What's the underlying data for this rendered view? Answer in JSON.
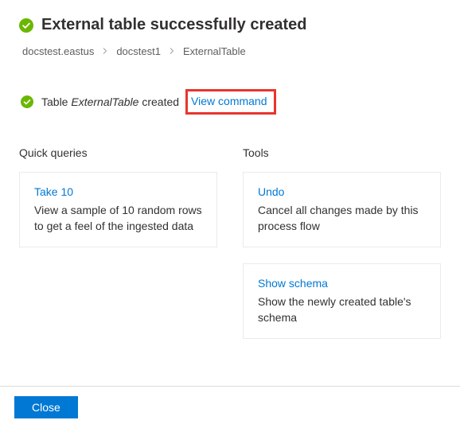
{
  "header": {
    "title": "External table successfully created"
  },
  "breadcrumb": {
    "items": [
      "docstest.eastus",
      "docstest1",
      "ExternalTable"
    ]
  },
  "status": {
    "prefix": "Table ",
    "table_name": "ExternalTable",
    "suffix": " created",
    "view_command_label": "View command"
  },
  "quick_queries": {
    "heading": "Quick queries",
    "cards": [
      {
        "title": "Take 10",
        "desc": "View a sample of 10 random rows to get a feel of the ingested data"
      }
    ]
  },
  "tools": {
    "heading": "Tools",
    "cards": [
      {
        "title": "Undo",
        "desc": "Cancel all changes made by this process flow"
      },
      {
        "title": "Show schema",
        "desc": "Show the newly created table's schema"
      }
    ]
  },
  "footer": {
    "close_label": "Close"
  },
  "colors": {
    "accent": "#0078d4",
    "success": "#6bb700",
    "highlight_border": "#e8352e"
  }
}
